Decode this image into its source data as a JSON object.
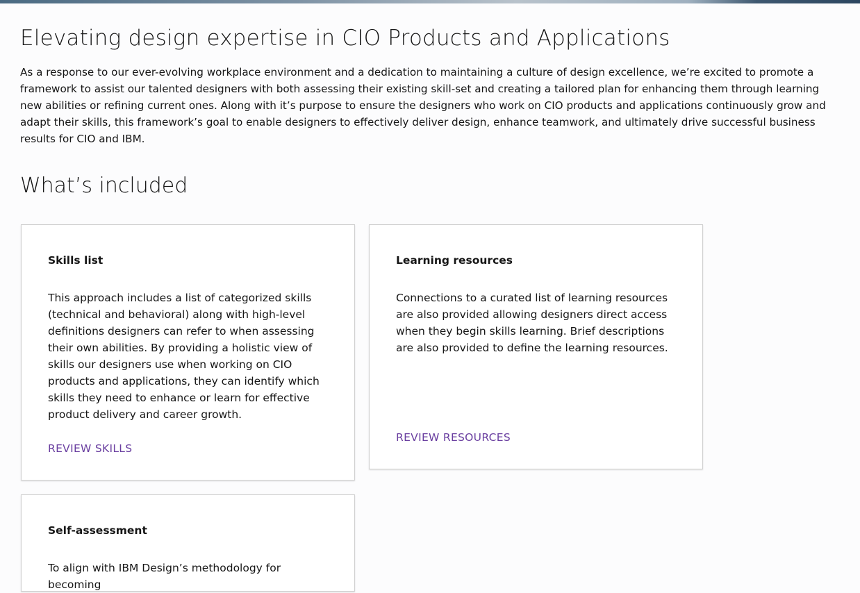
{
  "page": {
    "title": "Elevating design expertise in CIO Products and Applications",
    "intro": "As a response to our ever-evolving workplace environment and a dedication to maintaining a culture of design excellence, we’re excited to promote a framework to assist our talented designers with both assessing their existing skill-set and creating a tailored plan for enhancing them through learning new abilities or refining current ones. Along with it’s purpose to ensure the designers who work on CIO products and applications continuously grow and adapt their skills, this framework’s goal to enable designers to effectively deliver design, enhance teamwork, and ultimately drive successful business results for CIO and IBM.",
    "section_title": "What’s included"
  },
  "cards": [
    {
      "title": "Skills list",
      "body": "This approach includes a list of categorized skills (technical and behavioral) along with high-level definitions designers can refer to when assessing their own abilities. By providing a holistic view of skills our designers use when working on CIO products and applications, they can identify which skills they need to enhance or learn for effective product delivery and career growth.",
      "link": "REVIEW SKILLS"
    },
    {
      "title": "Learning resources",
      "body": "Connections to a curated list of learning resources are also provided allowing designers direct access when they begin skills learning. Brief descriptions are also provided to define the learning resources.",
      "link": "REVIEW RESOURCES"
    },
    {
      "title": "Self-assessment",
      "body": "To align with IBM Design’s methodology for becoming"
    }
  ],
  "colors": {
    "link": "#6a3fa0",
    "text": "#161616",
    "card_border": "#d0d0d0"
  }
}
